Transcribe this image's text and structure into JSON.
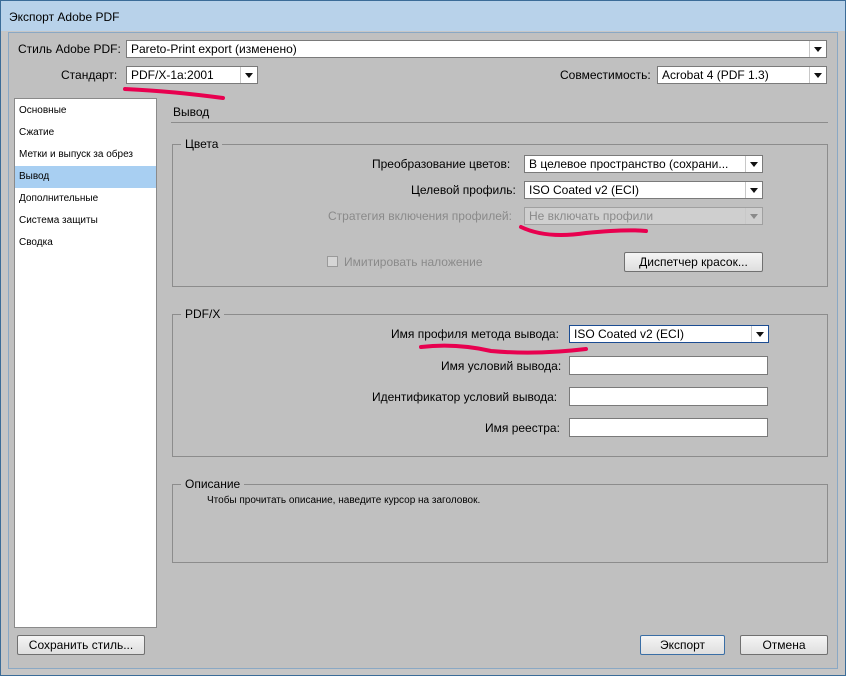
{
  "window": {
    "title": "Экспорт Adobe PDF"
  },
  "header": {
    "style_label": "Стиль Adobe PDF:",
    "style_value": "Pareto-Print export (изменено)",
    "standard_label": "Стандарт:",
    "standard_value": "PDF/X-1a:2001",
    "compat_label": "Совместимость:",
    "compat_value": "Acrobat 4 (PDF 1.3)"
  },
  "sidebar": {
    "items": [
      {
        "label": "Основные"
      },
      {
        "label": "Сжатие"
      },
      {
        "label": "Метки и выпуск за обрез"
      },
      {
        "label": "Вывод",
        "active": true
      },
      {
        "label": "Дополнительные"
      },
      {
        "label": "Система защиты"
      },
      {
        "label": "Сводка"
      }
    ]
  },
  "section": {
    "title": "Вывод"
  },
  "colors": {
    "group_title": "Цвета",
    "conversion_label": "Преобразование цветов:",
    "conversion_value": "В целевое пространство (сохрани...",
    "target_label": "Целевой профиль:",
    "target_value": "ISO Coated v2 (ECI)",
    "inclusion_label": "Стратегия включения профилей:",
    "inclusion_value": "Не включать профили",
    "simulate_label": "Имитировать наложение",
    "ink_manager_label": "Диспетчер красок..."
  },
  "pdfx": {
    "group_title": "PDF/X",
    "intent_label": "Имя профиля метода вывода:",
    "intent_value": "ISO Coated v2 (ECI)",
    "condition_name_label": "Имя условий вывода:",
    "condition_name_value": "",
    "condition_id_label": "Идентификатор условий вывода:",
    "condition_id_value": "",
    "registry_label": "Имя реестра:",
    "registry_value": ""
  },
  "description": {
    "group_title": "Описание",
    "text": "Чтобы прочитать описание, наведите курсор на заголовок."
  },
  "footer": {
    "save_style_label": "Сохранить стиль...",
    "export_label": "Экспорт",
    "cancel_label": "Отмена"
  },
  "accent": {
    "highlight_mark": "#e8004f",
    "selection": "#a8cff2"
  }
}
